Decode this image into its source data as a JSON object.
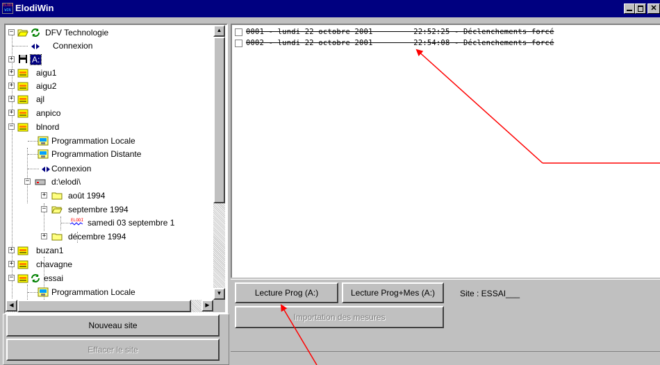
{
  "window": {
    "title": "ElodiWin",
    "icon_text_1": "ELODI",
    "icon_text_2": "WIN"
  },
  "tree": {
    "nodes": [
      {
        "id": "root",
        "label": "DFV Technologie",
        "icon": "open-folder-icon"
      },
      {
        "id": "connexion-1",
        "label": "Connexion",
        "icon": "connection-icon"
      },
      {
        "id": "drive-a",
        "label": "A:",
        "icon": "floppy-icon"
      },
      {
        "id": "aigu1",
        "label": "aigu1",
        "icon": "site-icon"
      },
      {
        "id": "aigu2",
        "label": "aigu2",
        "icon": "site-icon"
      },
      {
        "id": "ajl",
        "label": "ajl",
        "icon": "site-icon"
      },
      {
        "id": "anpico",
        "label": "anpico",
        "icon": "site-icon"
      },
      {
        "id": "blnord",
        "label": "blnord",
        "icon": "site-icon"
      },
      {
        "id": "prog-locale",
        "label": "Programmation Locale",
        "icon": "programming-icon"
      },
      {
        "id": "prog-distante",
        "label": "Programmation Distante",
        "icon": "programming-icon"
      },
      {
        "id": "connexion-2",
        "label": "Connexion",
        "icon": "connection-icon"
      },
      {
        "id": "d-elodi",
        "label": "d:\\elodi\\",
        "icon": "drive-icon"
      },
      {
        "id": "aout-1994",
        "label": "août 1994",
        "icon": "folder-icon"
      },
      {
        "id": "sept-1994",
        "label": "septembre 1994",
        "icon": "open-folder-icon"
      },
      {
        "id": "samedi-03",
        "label": "samedi 03 septembre 1",
        "icon": "elodi-record-icon"
      },
      {
        "id": "dec-1994",
        "label": "décembre 1994",
        "icon": "folder-icon"
      },
      {
        "id": "buzan1",
        "label": "buzan1",
        "icon": "site-icon"
      },
      {
        "id": "chavagne",
        "label": "chavagne",
        "icon": "site-icon"
      },
      {
        "id": "essai",
        "label": "essai",
        "icon": "site-icon"
      },
      {
        "id": "prog-locale-2",
        "label": "Programmation Locale",
        "icon": "programming-icon"
      }
    ]
  },
  "left_buttons": {
    "new_site": "Nouveau site",
    "delete_site": "Effacer le site"
  },
  "log": {
    "rows": [
      {
        "text": "0001 - lundi 22 octobre 2001         22:52:25 - Déclenchements forcé"
      },
      {
        "text": "0002 - lundi 22 octobre 2001         22:54:08 - Déclenchements forcé"
      }
    ]
  },
  "toolbar": {
    "read_prog": "Lecture Prog (A:)",
    "read_prog_mes": "Lecture Prog+Mes (A:)",
    "site_label": "Site : ESSAI___",
    "import": "Importation des mesures"
  },
  "colors": {
    "titlebar": "#000080",
    "face": "#c0c0c0",
    "annotation_arrow": "#ff0000"
  }
}
